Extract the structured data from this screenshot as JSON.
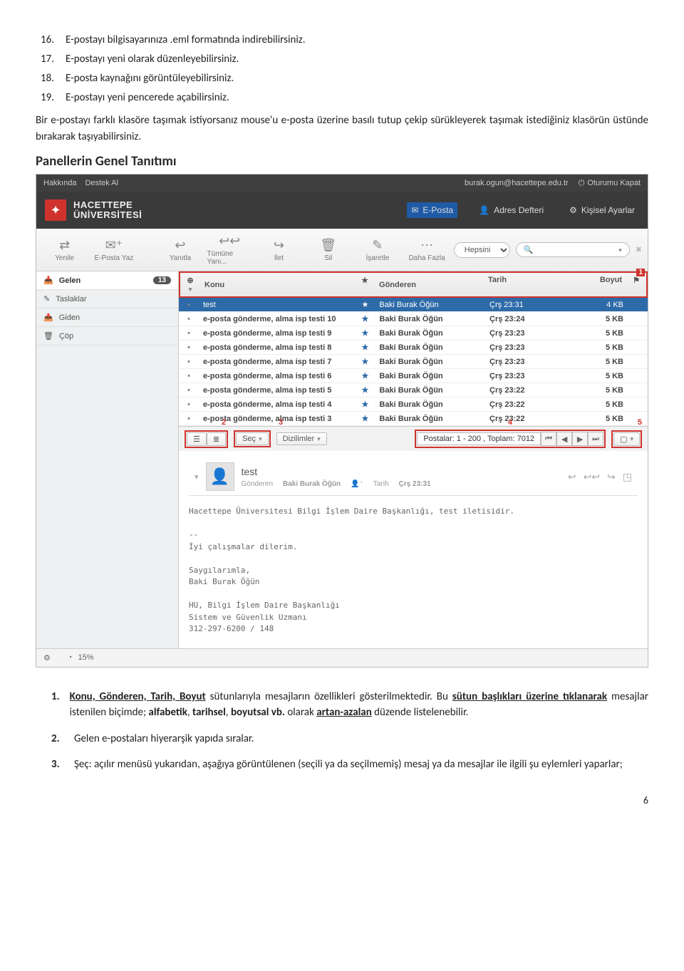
{
  "intro_items": [
    {
      "n": "16.",
      "t": "E-postayı bilgisayarınıza .eml formatında indirebilirsiniz."
    },
    {
      "n": "17.",
      "t": "E-postayı yeni olarak düzenleyebilirsiniz."
    },
    {
      "n": "18.",
      "t": "E-posta kaynağını görüntüleyebilirsiniz."
    },
    {
      "n": "19.",
      "t": "E-postayı yeni pencerede açabilirsiniz."
    }
  ],
  "intro_para": "Bir e-postayı farklı klasöre taşımak istiyorsanız mouse'u e-posta üzerine basılı tutup çekip sürükleyerek taşımak istediğiniz klasörün üstünde bırakarak taşıyabilirsiniz.",
  "section_title": "Panellerin Genel Tanıtımı",
  "topbar": {
    "about": "Hakkında",
    "support": "Destek Al",
    "user": "burak.ogun@hacettepe.edu.tr",
    "logout": "Oturumu Kapat"
  },
  "logo": {
    "line1": "HACETTEPE",
    "line2": "ÜNİVERSİTESİ"
  },
  "tabs": {
    "mail": "E-Posta",
    "addr": "Adres Defteri",
    "settings": "Kişisel Ayarlar"
  },
  "tools": {
    "refresh": "Yenile",
    "compose": "E-Posta Yaz",
    "reply": "Yanıtla",
    "replyall": "Tümüne Yanı...",
    "forward": "İlet",
    "delete": "Sil",
    "mark": "İşaretle",
    "more": "Daha Fazla",
    "filter": "Hepsini"
  },
  "folders": {
    "inbox": "Gelen",
    "inbox_badge": "13",
    "drafts": "Taslaklar",
    "sent": "Giden",
    "trash": "Çöp"
  },
  "cols": {
    "subject": "Konu",
    "from": "Gönderen",
    "date": "Tarih",
    "size": "Boyut"
  },
  "callouts": {
    "c1": "1",
    "c2": "2",
    "c3": "3",
    "c4": "4",
    "c5": "5"
  },
  "rows": [
    {
      "subject": "test",
      "from": "Baki Burak Öğün",
      "date": "Çrş 23:31",
      "size": "4 KB"
    },
    {
      "subject": "e-posta gönderme, alma isp testi 10",
      "from": "Baki Burak Öğün",
      "date": "Çrş 23:24",
      "size": "5 KB"
    },
    {
      "subject": "e-posta gönderme, alma isp testi 9",
      "from": "Baki Burak Öğün",
      "date": "Çrş 23:23",
      "size": "5 KB"
    },
    {
      "subject": "e-posta gönderme, alma isp testi 8",
      "from": "Baki Burak Öğün",
      "date": "Çrş 23:23",
      "size": "5 KB"
    },
    {
      "subject": "e-posta gönderme, alma isp testi 7",
      "from": "Baki Burak Öğün",
      "date": "Çrş 23:23",
      "size": "5 KB"
    },
    {
      "subject": "e-posta gönderme, alma isp testi 6",
      "from": "Baki Burak Öğün",
      "date": "Çrş 23:23",
      "size": "5 KB"
    },
    {
      "subject": "e-posta gönderme, alma isp testi 5",
      "from": "Baki Burak Öğün",
      "date": "Çrş 23:22",
      "size": "5 KB"
    },
    {
      "subject": "e-posta gönderme, alma isp testi 4",
      "from": "Baki Burak Öğün",
      "date": "Çrş 23:22",
      "size": "5 KB"
    },
    {
      "subject": "e-posta gönderme, alma isp testi 3",
      "from": "Baki Burak Öğün",
      "date": "Çrş 23:22",
      "size": "5 KB"
    }
  ],
  "viewbar": {
    "select": "Seç",
    "threads": "Dizilimler",
    "pager": "Postalar: 1 - 200 , Toplam: 7012"
  },
  "preview": {
    "subject": "test",
    "from_label": "Gönderen",
    "from": "Baki Burak Öğün",
    "date_label": "Tarih",
    "date": "Çrş 23:31",
    "body": "Hacettepe Üniversitesi Bilgi İşlem Daire Başkanlığı, test iletisidir.\n\n--\nİyi çalışmalar dilerim.\n\nSaygılarımla,\nBaki Burak Öğün\n\nHU, Bilgi İşlem Daire Başkanlığı\nSistem ve Güvenlik Uzmanı\n312-297-6200 / 148"
  },
  "footer": {
    "usage": "15%"
  },
  "bottom_notes": {
    "n1_a": "Konu, Gönderen, Tarih, Boyut",
    "n1_b": " sütunlarıyla mesajların özellikleri gösterilmektedir. Bu ",
    "n1_c": "sütun başlıkları üzerine tıklanarak",
    "n1_d": " mesajlar istenilen biçimde; ",
    "n1_e": "alfabetik",
    "n1_f": ", ",
    "n1_g": "tarihsel",
    "n1_h": ", ",
    "n1_i": "boyutsal vb.",
    "n1_j": " olarak ",
    "n1_k": "artan-azalan",
    "n1_l": " düzende listelenebilir.",
    "n2": "Gelen e-postaları hiyerarşik yapıda sıralar.",
    "n3": "Şeç: açılır menüsü yukarıdan, aşağıya görüntülenen (seçili ya da seçilmemiş) mesaj ya da mesajlar ile ilgili şu eylemleri yaparlar;"
  },
  "page_no": "6"
}
